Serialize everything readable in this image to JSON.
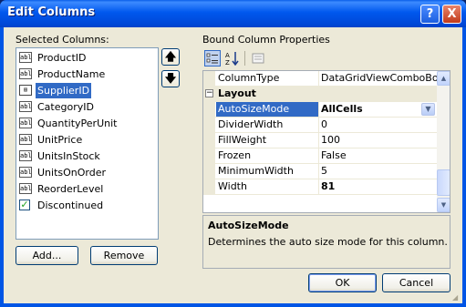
{
  "window": {
    "title": "Edit Columns"
  },
  "left": {
    "label": "Selected Columns:",
    "items": [
      {
        "icon": "abl",
        "label": "ProductID"
      },
      {
        "icon": "abl",
        "label": "ProductName"
      },
      {
        "icon": "combo",
        "label": "SupplierID"
      },
      {
        "icon": "abl",
        "label": "CategoryID"
      },
      {
        "icon": "abl",
        "label": "QuantityPerUnit"
      },
      {
        "icon": "abl",
        "label": "UnitPrice"
      },
      {
        "icon": "abl",
        "label": "UnitsInStock"
      },
      {
        "icon": "abl",
        "label": "UnitsOnOrder"
      },
      {
        "icon": "abl",
        "label": "ReorderLevel"
      },
      {
        "icon": "check",
        "label": "Discontinued"
      }
    ],
    "selected": "SupplierID",
    "add_label": "Add...",
    "remove_label": "Remove",
    "up_glyph": "🡅",
    "down_glyph": "🡇"
  },
  "right": {
    "label": "Bound Column Properties",
    "toolbar": {
      "categorized_icon": "categorized-icon",
      "alphabetical_icon": "alphabetical-icon",
      "pages_icon": "property-pages-icon"
    },
    "rows": [
      {
        "kind": "prop",
        "name": "ColumnType",
        "value": "DataGridViewComboBoxCo"
      },
      {
        "kind": "cat",
        "name": "Layout",
        "toggle": "−"
      },
      {
        "kind": "prop",
        "name": "AutoSizeMode",
        "value": "AllCells",
        "bold": true,
        "selected": true,
        "dropdown": "▼"
      },
      {
        "kind": "prop",
        "name": "DividerWidth",
        "value": "0"
      },
      {
        "kind": "prop",
        "name": "FillWeight",
        "value": "100"
      },
      {
        "kind": "prop",
        "name": "Frozen",
        "value": "False"
      },
      {
        "kind": "prop",
        "name": "MinimumWidth",
        "value": "5"
      },
      {
        "kind": "prop",
        "name": "Width",
        "value": "81",
        "bold": true
      }
    ],
    "description": {
      "title": "AutoSizeMode",
      "text": "Determines the auto size mode for this column."
    }
  },
  "buttons": {
    "ok": "OK",
    "cancel": "Cancel",
    "help": "?",
    "close": "X"
  },
  "colors": {
    "title_bar": "#0058ee",
    "selection": "#316ac5",
    "dialog_bg": "#ece9d8"
  }
}
